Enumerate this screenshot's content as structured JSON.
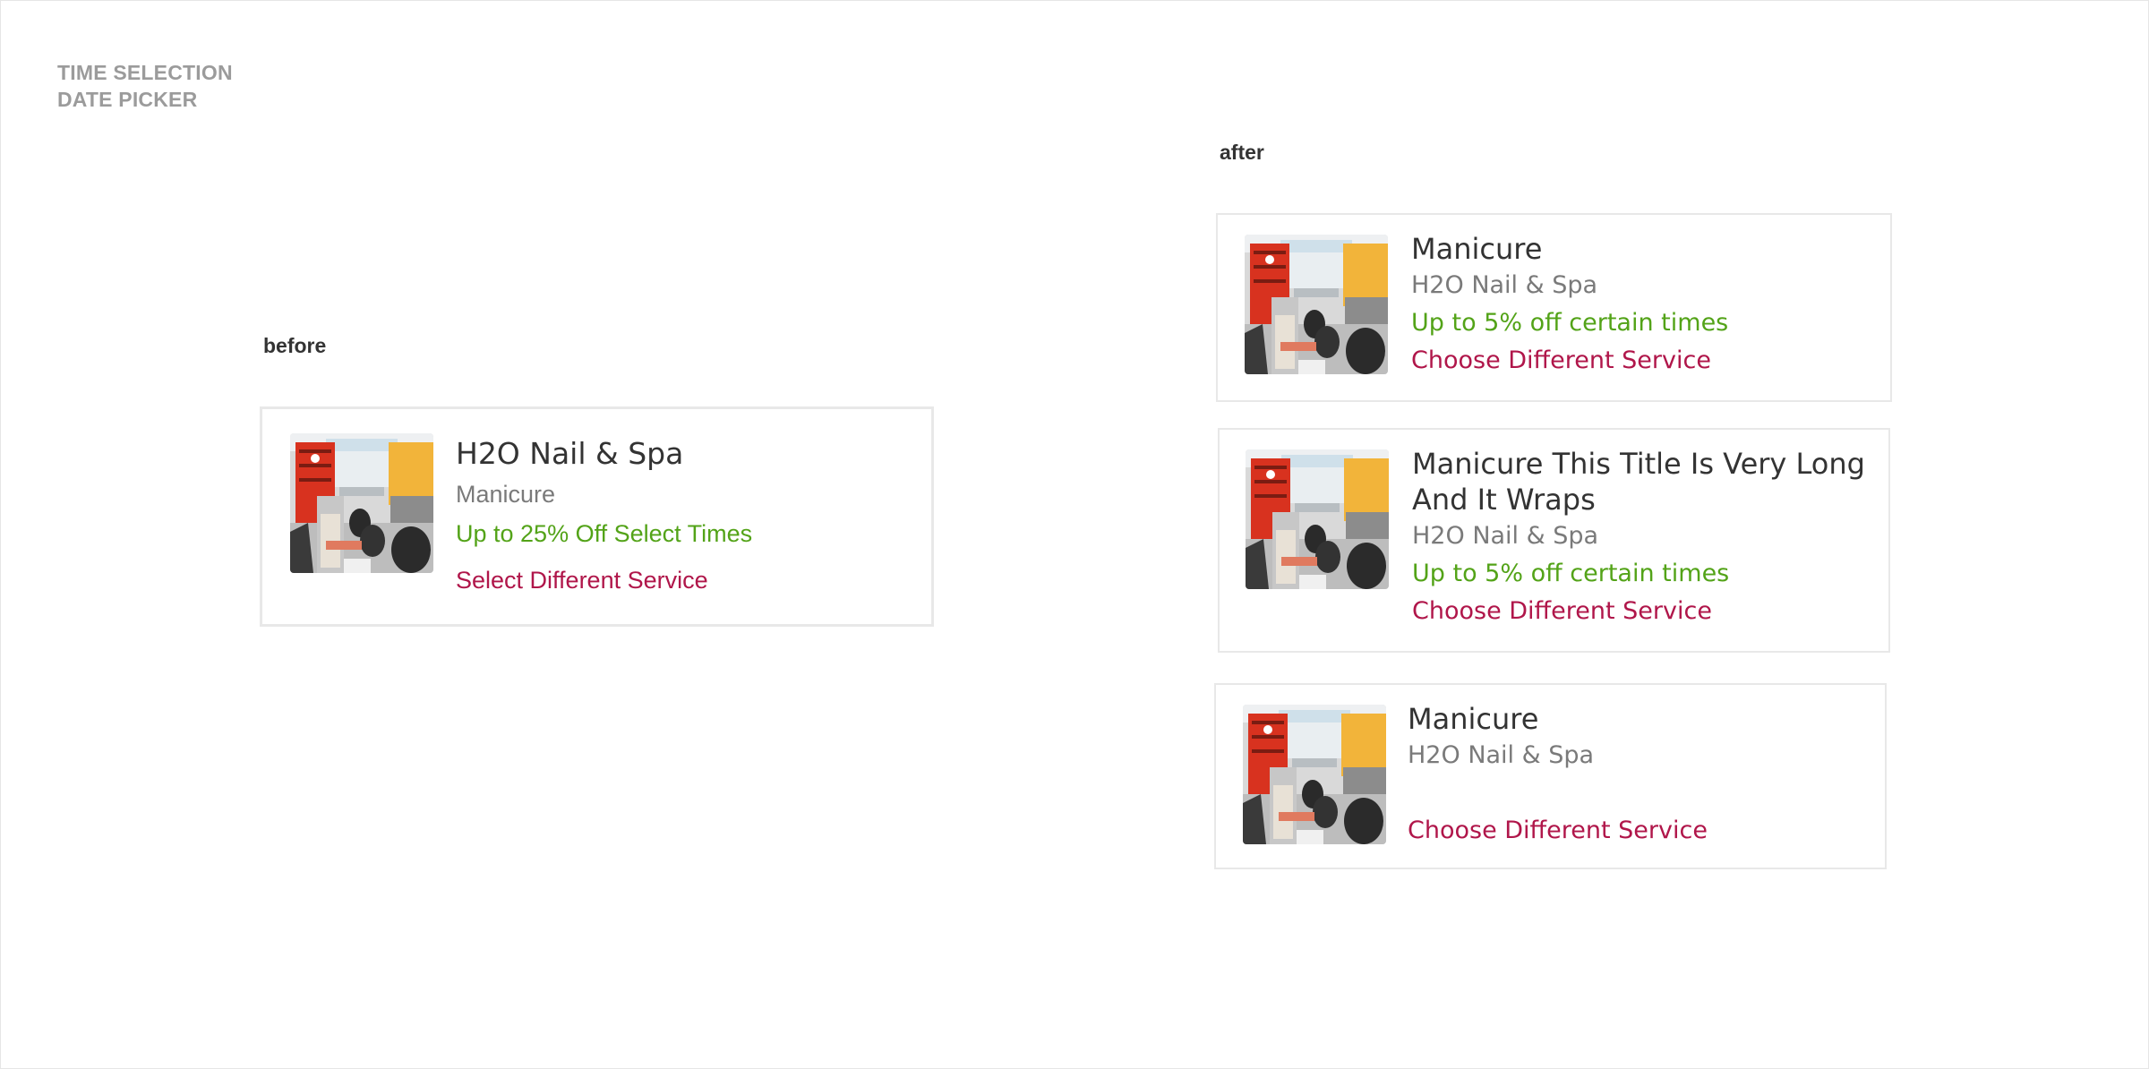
{
  "heading": {
    "line1": "TIME SELECTION",
    "line2": "DATE PICKER"
  },
  "before": {
    "label": "before",
    "card": {
      "image": "salon-photo",
      "title": "H2O Nail & Spa",
      "subtitle": "Manicure",
      "deal": "Up to 25% Off Select Times",
      "action": "Select Different Service"
    }
  },
  "after": {
    "label": "after",
    "cards": [
      {
        "image": "salon-photo",
        "title": "Manicure",
        "subtitle": "H2O Nail & Spa",
        "deal": "Up to 5% off certain times",
        "action": "Choose Different Service"
      },
      {
        "image": "salon-photo",
        "title": "Manicure This Title Is Very Long And It Wraps",
        "subtitle": "H2O Nail & Spa",
        "deal": "Up to 5% off certain times",
        "action": "Choose Different Service"
      },
      {
        "image": "salon-photo",
        "title": "Manicure",
        "subtitle": "H2O Nail & Spa",
        "deal": "",
        "action": "Choose Different Service"
      }
    ]
  },
  "colors": {
    "deal": "#53a318",
    "action": "#b0164a",
    "title": "#333333",
    "subtitle": "#7a7a7a",
    "heading": "#9b9b9b",
    "border": "#e8e8e8"
  }
}
